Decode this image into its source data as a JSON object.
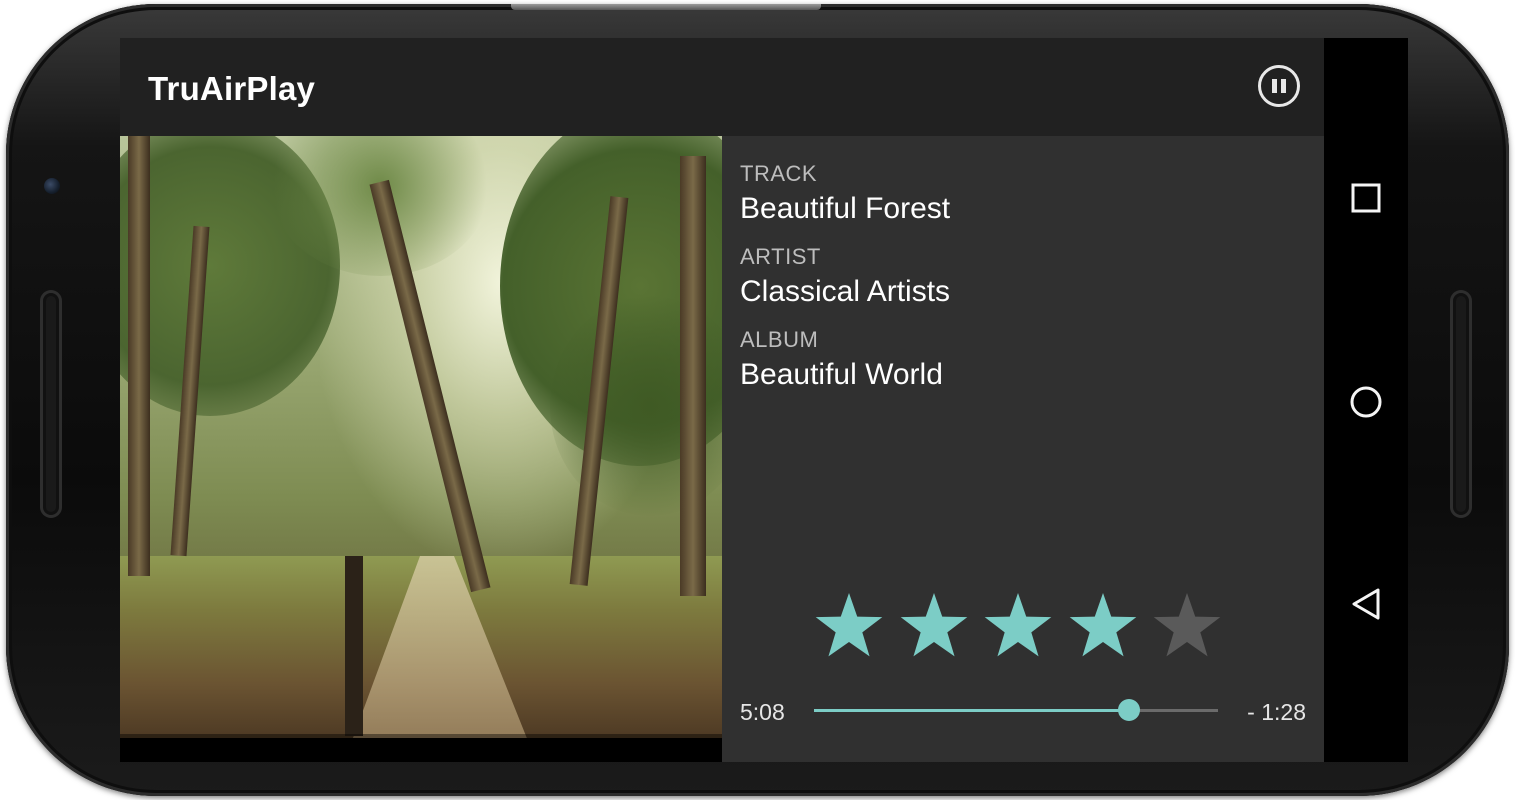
{
  "app": {
    "title": "TruAirPlay"
  },
  "actionbar": {
    "pause_icon": "pause-circle-icon"
  },
  "album_art": {
    "description_icon": "forest-artwork"
  },
  "track_info": {
    "track_label": "TRACK",
    "track_value": "Beautiful Forest",
    "artist_label": "ARTIST",
    "artist_value": "Classical Artists",
    "album_label": "ALBUM",
    "album_value": "Beautiful World"
  },
  "rating": {
    "value": 4,
    "max": 5,
    "filled_color": "#7ccdc6",
    "empty_color": "#5a5a5a"
  },
  "playback": {
    "elapsed": "5:08",
    "remaining": "- 1:28",
    "progress": 0.78,
    "accent_color": "#7ccdc6"
  },
  "controls": {
    "shuffle_icon": "shuffle-icon",
    "previous_icon": "skip-previous-icon",
    "play_pause_icon": "pause-icon",
    "next_icon": "skip-next-icon"
  },
  "system_nav": {
    "recents_icon": "square-recents-icon",
    "home_icon": "circle-home-icon",
    "back_icon": "triangle-back-icon"
  }
}
